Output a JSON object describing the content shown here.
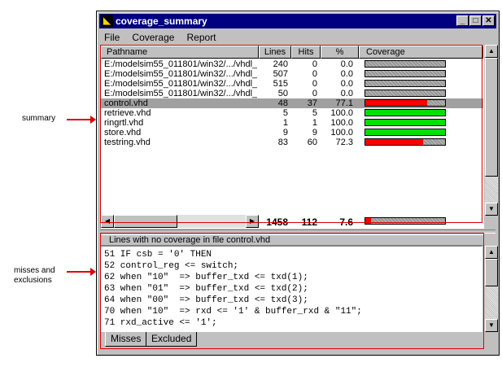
{
  "annotations": {
    "summary": "summary",
    "misses": "misses and exclusions"
  },
  "window": {
    "title": "coverage_summary",
    "controls": {
      "minimize": "_",
      "maximize": "□",
      "close": "✕"
    }
  },
  "menu": [
    "File",
    "Coverage",
    "Report"
  ],
  "table": {
    "columns": {
      "path": "Pathname",
      "lines": "Lines",
      "hits": "Hits",
      "pct": "%",
      "coverage": "Coverage"
    },
    "rows": [
      {
        "path": "E:/modelsim55_011801/win32/.../vhdl_",
        "lines": "240",
        "hits": "0",
        "pct": "0.0",
        "coverage": 0.0,
        "selected": false
      },
      {
        "path": "E:/modelsim55_011801/win32/.../vhdl_",
        "lines": "507",
        "hits": "0",
        "pct": "0.0",
        "coverage": 0.0,
        "selected": false
      },
      {
        "path": "E:/modelsim55_011801/win32/.../vhdl_",
        "lines": "515",
        "hits": "0",
        "pct": "0.0",
        "coverage": 0.0,
        "selected": false
      },
      {
        "path": "E:/modelsim55_011801/win32/.../vhdl_",
        "lines": "50",
        "hits": "0",
        "pct": "0.0",
        "coverage": 0.0,
        "selected": false
      },
      {
        "path": "control.vhd",
        "lines": "48",
        "hits": "37",
        "pct": "77.1",
        "coverage": 77.1,
        "selected": true
      },
      {
        "path": "retrieve.vhd",
        "lines": "5",
        "hits": "5",
        "pct": "100.0",
        "coverage": 100.0,
        "selected": false
      },
      {
        "path": "ringrtl.vhd",
        "lines": "1",
        "hits": "1",
        "pct": "100.0",
        "coverage": 100.0,
        "selected": false
      },
      {
        "path": "store.vhd",
        "lines": "9",
        "hits": "9",
        "pct": "100.0",
        "coverage": 100.0,
        "selected": false
      },
      {
        "path": "testring.vhd",
        "lines": "83",
        "hits": "60",
        "pct": "72.3",
        "coverage": 72.3,
        "selected": false
      }
    ],
    "totals": {
      "lines": "1458",
      "hits": "112",
      "pct": "7.6",
      "coverage": 7.6
    }
  },
  "colors": {
    "full": "#00e000",
    "partial": "#ff0000",
    "annotation": "#e00000"
  },
  "misses_panel": {
    "header": "Lines with no coverage in file control.vhd",
    "lines": [
      "51 IF csb = '0' THEN",
      "52 control_reg <= switch;",
      "62 when \"10\"  => buffer_txd <= txd(1);",
      "63 when \"01\"  => buffer_txd <= txd(2);",
      "64 when \"00\"  => buffer_txd <= txd(3);",
      "70 when \"10\"  => rxd <= '1' & buffer_rxd & \"11\";",
      "71 rxd_active <= '1';"
    ]
  },
  "tabs": [
    "Misses",
    "Excluded"
  ]
}
